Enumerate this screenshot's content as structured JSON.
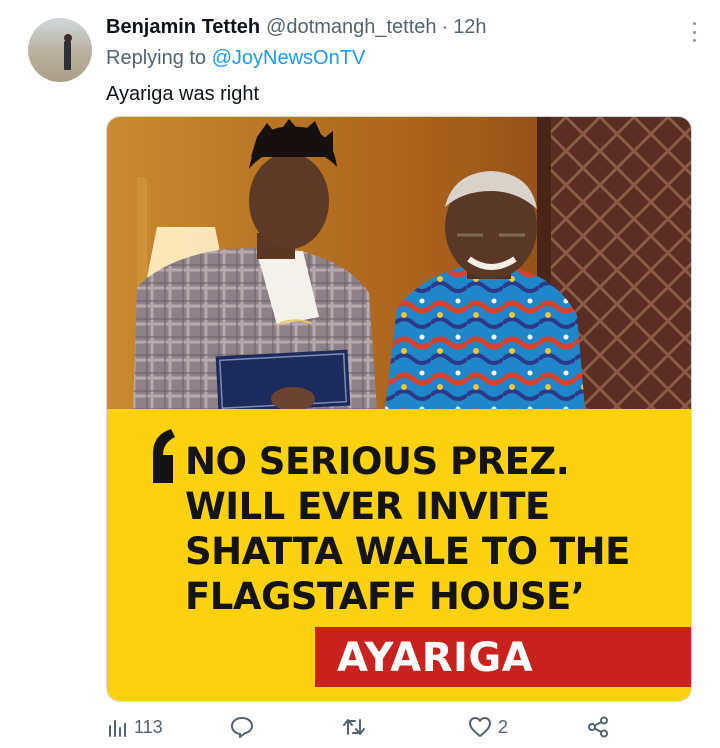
{
  "tweet": {
    "author_name": "Benjamin Tetteh",
    "author_handle": "@dotmangh_tetteh",
    "separator": "·",
    "time": "12h",
    "replying_to_label": "Replying to",
    "replying_to_handle": "@JoyNewsOnTV",
    "text": "Ayariga was right"
  },
  "media": {
    "headline_lines": [
      "NO SERIOUS PREZ.",
      "WILL EVER INVITE",
      "SHATTA  WALE TO THE",
      "FLAGSTAFF HOUSE’"
    ],
    "tag": "AYARIGA",
    "colors": {
      "banner": "#fcd10f",
      "tag": "#c9221e"
    }
  },
  "actions": {
    "views_icon": "views-bar-chart-icon",
    "views_count": "113",
    "reply_icon": "reply-bubble-icon",
    "retweet_icon": "retweet-icon",
    "like_icon": "heart-icon",
    "like_count": "2",
    "share_icon": "share-icon"
  },
  "colors": {
    "link": "#1d9bf0",
    "secondary_text": "#536471"
  }
}
